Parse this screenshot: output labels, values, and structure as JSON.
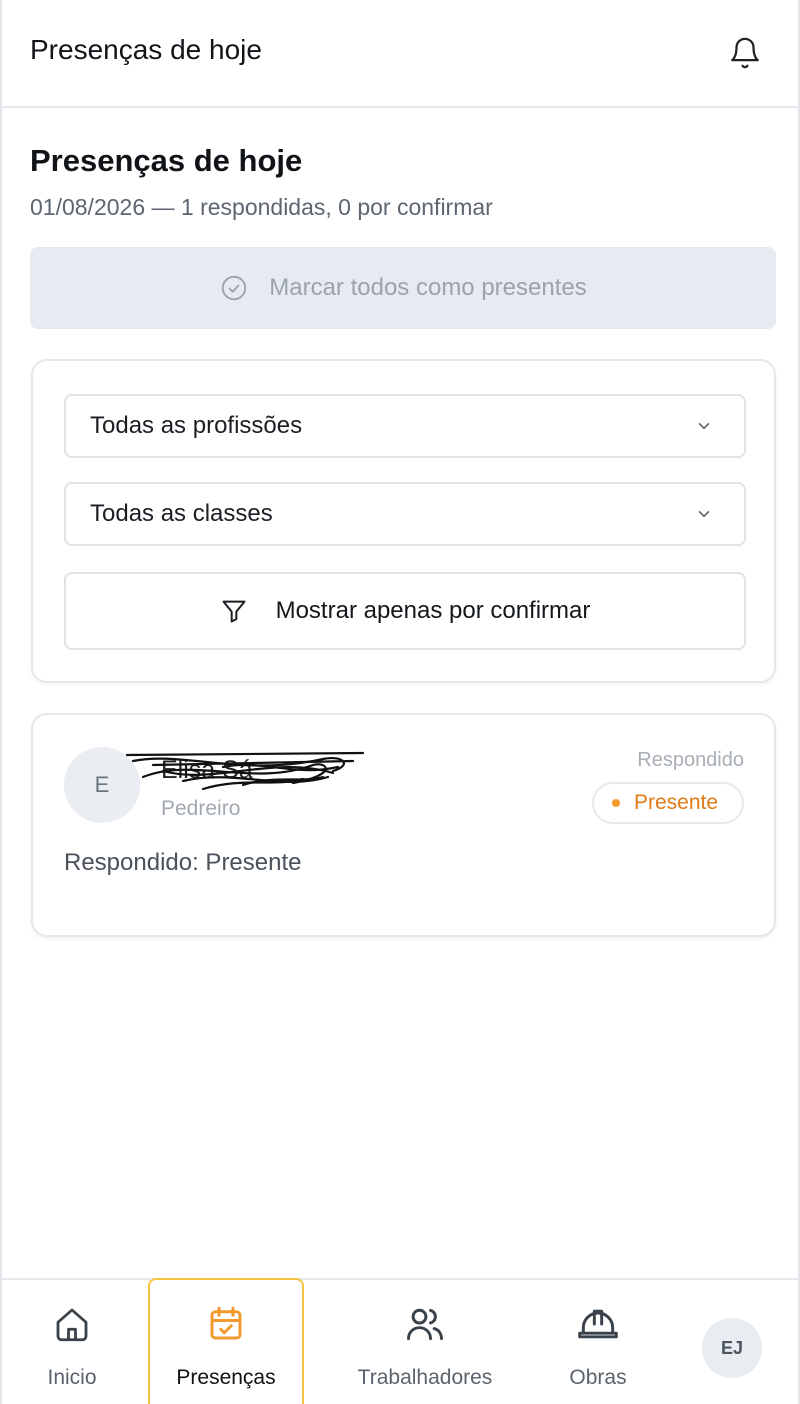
{
  "topbar": {
    "title": "Presenças de hoje",
    "bell_icon": "bell-icon"
  },
  "page": {
    "title": "Presenças de hoje",
    "subtitle": "01/08/2026 — 1 respondidas, 0 por confirmar",
    "mark_all_label": "Marcar todos como presentes"
  },
  "filters": {
    "profession": "Todas as profissões",
    "class": "Todas as classes",
    "show_pending_label": "Mostrar apenas por confirmar"
  },
  "worker": {
    "initial": "E",
    "name": "Elisa Sá",
    "role": "Pedreiro",
    "response_label": "Respondido",
    "status": "Presente",
    "response_line": "Respondido: Presente"
  },
  "nav": {
    "items": [
      {
        "label": "Inicio",
        "icon": "home-icon"
      },
      {
        "label": "Presenças",
        "icon": "calendar-check-icon"
      },
      {
        "label": "Trabalhadores",
        "icon": "users-icon"
      },
      {
        "label": "Obras",
        "icon": "hard-hat-icon"
      }
    ],
    "avatar_initials": "EJ"
  },
  "colors": {
    "accent": "#f6c343",
    "accent_icon": "#f29a2e",
    "status": "#e07a14"
  }
}
